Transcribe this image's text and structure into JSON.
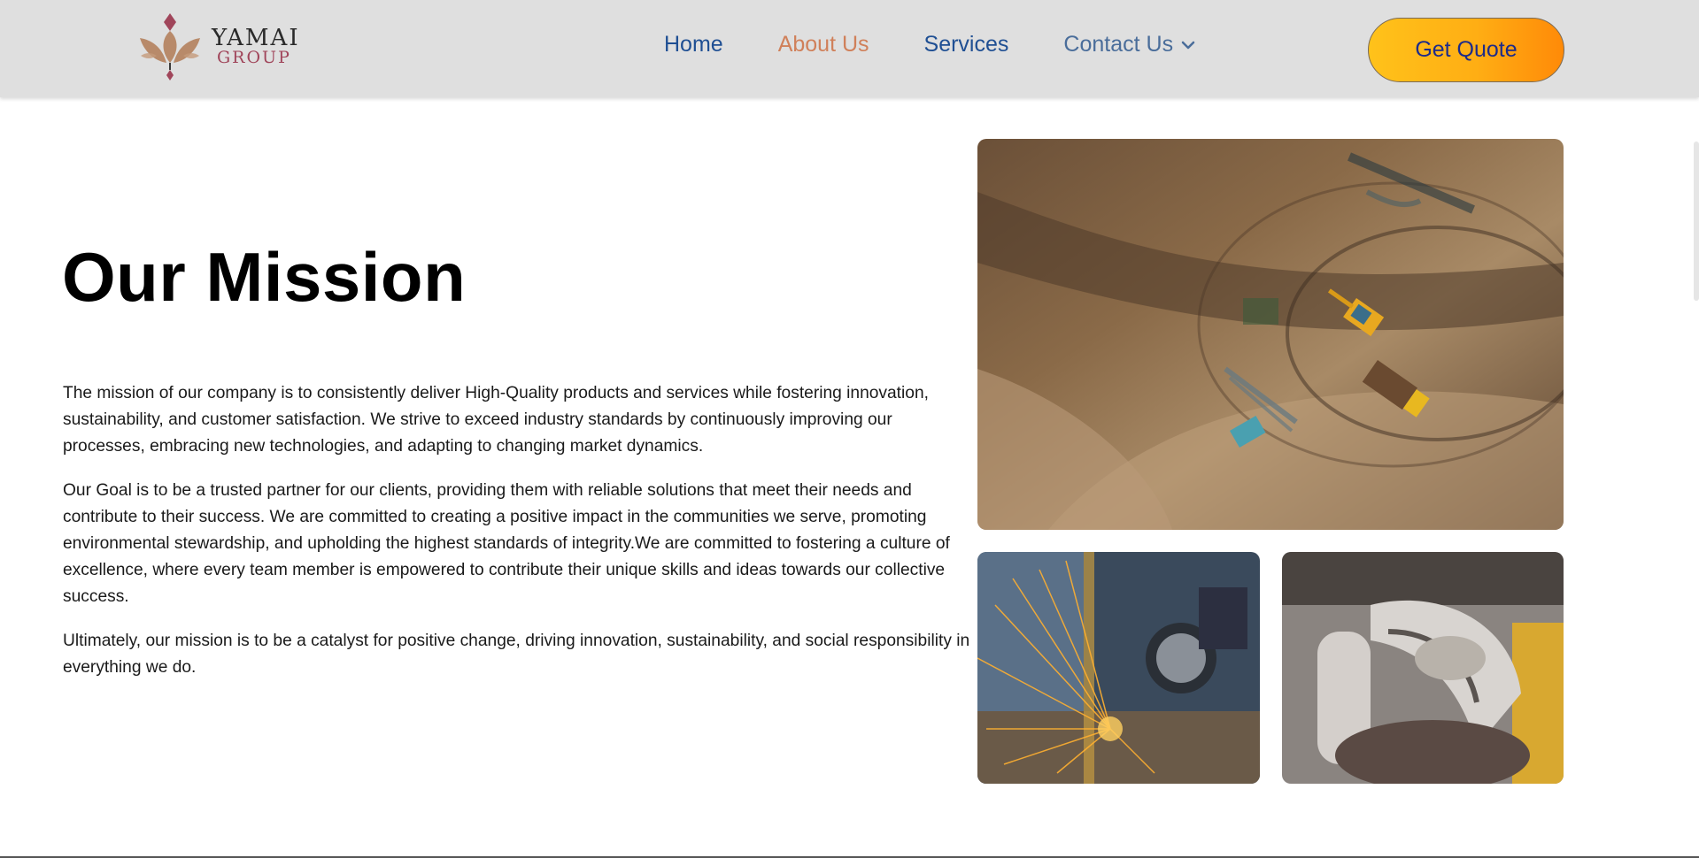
{
  "brand": {
    "name": "YAMAI",
    "sub": "GROUP",
    "colors": {
      "leaf": "#b88a6a",
      "accent": "#a0455a"
    }
  },
  "nav": {
    "items": [
      {
        "label": "Home",
        "state": "default"
      },
      {
        "label": "About Us",
        "state": "active"
      },
      {
        "label": "Services",
        "state": "default"
      },
      {
        "label": "Contact Us",
        "state": "dropdown"
      }
    ],
    "colors": {
      "link": "#1f4f93",
      "active": "#d0805a"
    }
  },
  "cta": {
    "label": "Get Quote"
  },
  "mission": {
    "title": "Our Mission",
    "paragraphs": [
      "The mission of our company is to consistently deliver High-Quality products and services while fostering innovation, sustainability, and customer satisfaction. We strive to exceed industry standards by continuously improving our processes, embracing new technologies, and adapting to changing market dynamics.",
      "Our Goal is to be a trusted partner for our clients, providing them with reliable solutions that meet their needs and contribute to their success. We are committed to creating a positive impact in the communities we serve, promoting environmental stewardship, and upholding the highest standards of integrity.We are committed to fostering a culture of excellence, where every team member is empowered to contribute their unique skills and ideas towards our collective success.",
      "Ultimately, our mission is to be a catalyst for positive change, driving innovation, sustainability, and social responsibility in everything we do."
    ]
  },
  "images": {
    "main": "aerial-construction-site-photo",
    "secondary": [
      "metal-grinding-sparks-photo",
      "industrial-machine-worker-photo"
    ]
  }
}
